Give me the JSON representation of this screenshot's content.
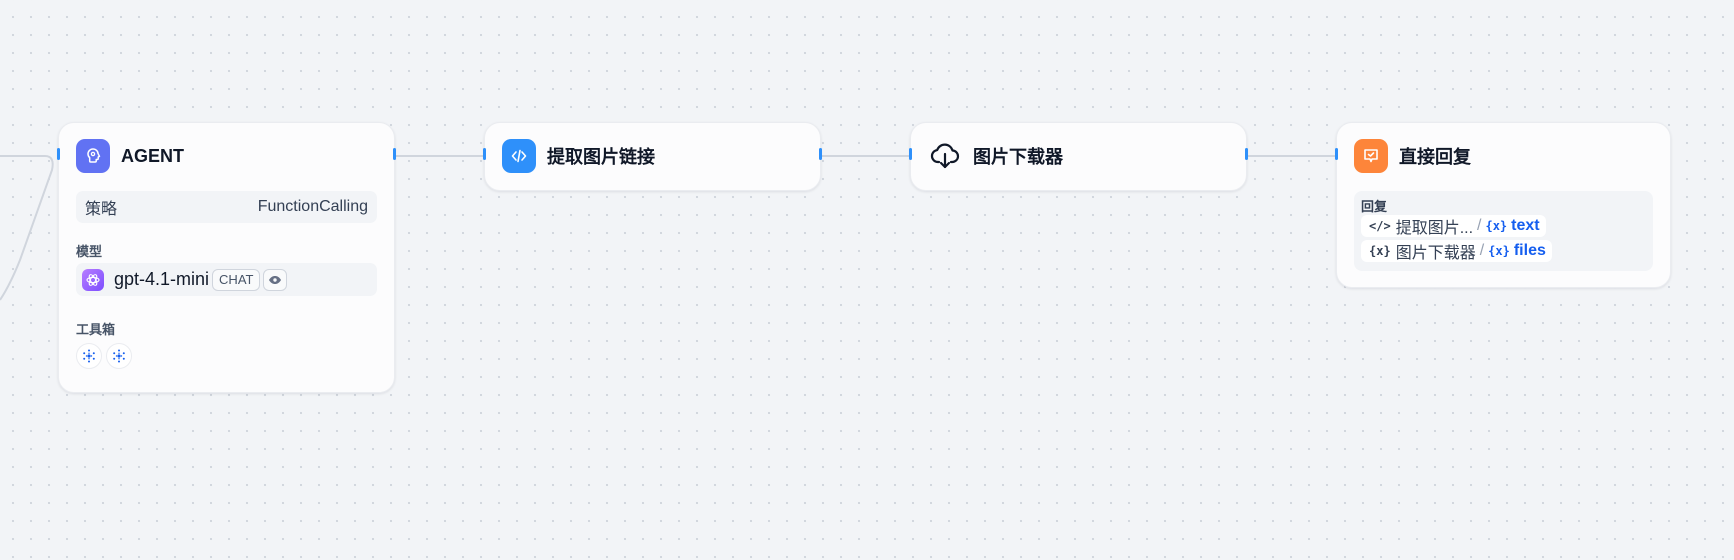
{
  "canvas": {
    "background": "#f2f4f7",
    "edge_color": "#d0d5dd",
    "handle_color": "#2e90fa"
  },
  "nodes": {
    "agent": {
      "title": "AGENT",
      "icon": "agent-brain-icon",
      "icon_color": "#6172f3",
      "strategy_label": "策略",
      "strategy_value": "FunctionCalling",
      "model_label": "模型",
      "model_name": "gpt-4.1-mini",
      "model_icon": "openai-icon",
      "model_badge": "CHAT",
      "model_vision_icon": "eye-icon",
      "toolbox_label": "工具箱",
      "tools": [
        "tool-icon",
        "tool-icon"
      ]
    },
    "extract": {
      "title": "提取图片链接",
      "icon": "code-icon",
      "icon_color": "#2e90fa"
    },
    "downloader": {
      "title": "图片下载器",
      "icon": "cloud-download-icon"
    },
    "reply": {
      "title": "直接回复",
      "icon": "reply-icon",
      "icon_color": "#fd853a",
      "reply_label": "回复",
      "variables": [
        {
          "node_icon": "</>",
          "node": "提取图片...",
          "sep": "/",
          "var_icon": "{x}",
          "name": "text"
        },
        {
          "node_icon": "{x}",
          "node": "图片下载器",
          "sep": "/",
          "var_icon": "{x}",
          "name": "files"
        }
      ]
    }
  }
}
